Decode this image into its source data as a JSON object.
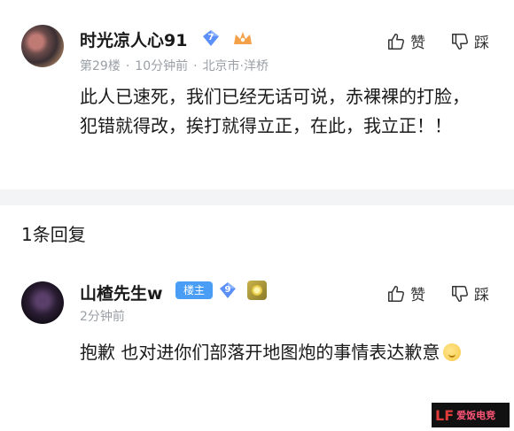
{
  "post": {
    "username": "时光凉人心91",
    "level": "7",
    "level_color": "#5b8ff9",
    "meta_floor": "第29楼",
    "meta_time": "10分钟前",
    "meta_location": "北京市·洋桥",
    "like_label": "赞",
    "tread_label": "踩",
    "content": "此人已速死，我们已经无话可说，赤裸裸的打脸，犯错就得改，挨打就得立正，在此，我立正！！"
  },
  "replies": {
    "count_label": "1条回复",
    "items": [
      {
        "username": "山楂先生w",
        "owner_tag": "楼主",
        "level": "9",
        "meta_time": "2分钟前",
        "like_label": "赞",
        "tread_label": "踩",
        "content": "抱歉 也对进你们部落开地图炮的事情表达歉意"
      }
    ]
  },
  "watermark": {
    "mark": "LF",
    "text": "爱饭电竞"
  },
  "colors": {
    "accent_blue": "#4a9df5",
    "meta_gray": "#9aa0a6",
    "divider_gray": "#f3f4f6"
  }
}
